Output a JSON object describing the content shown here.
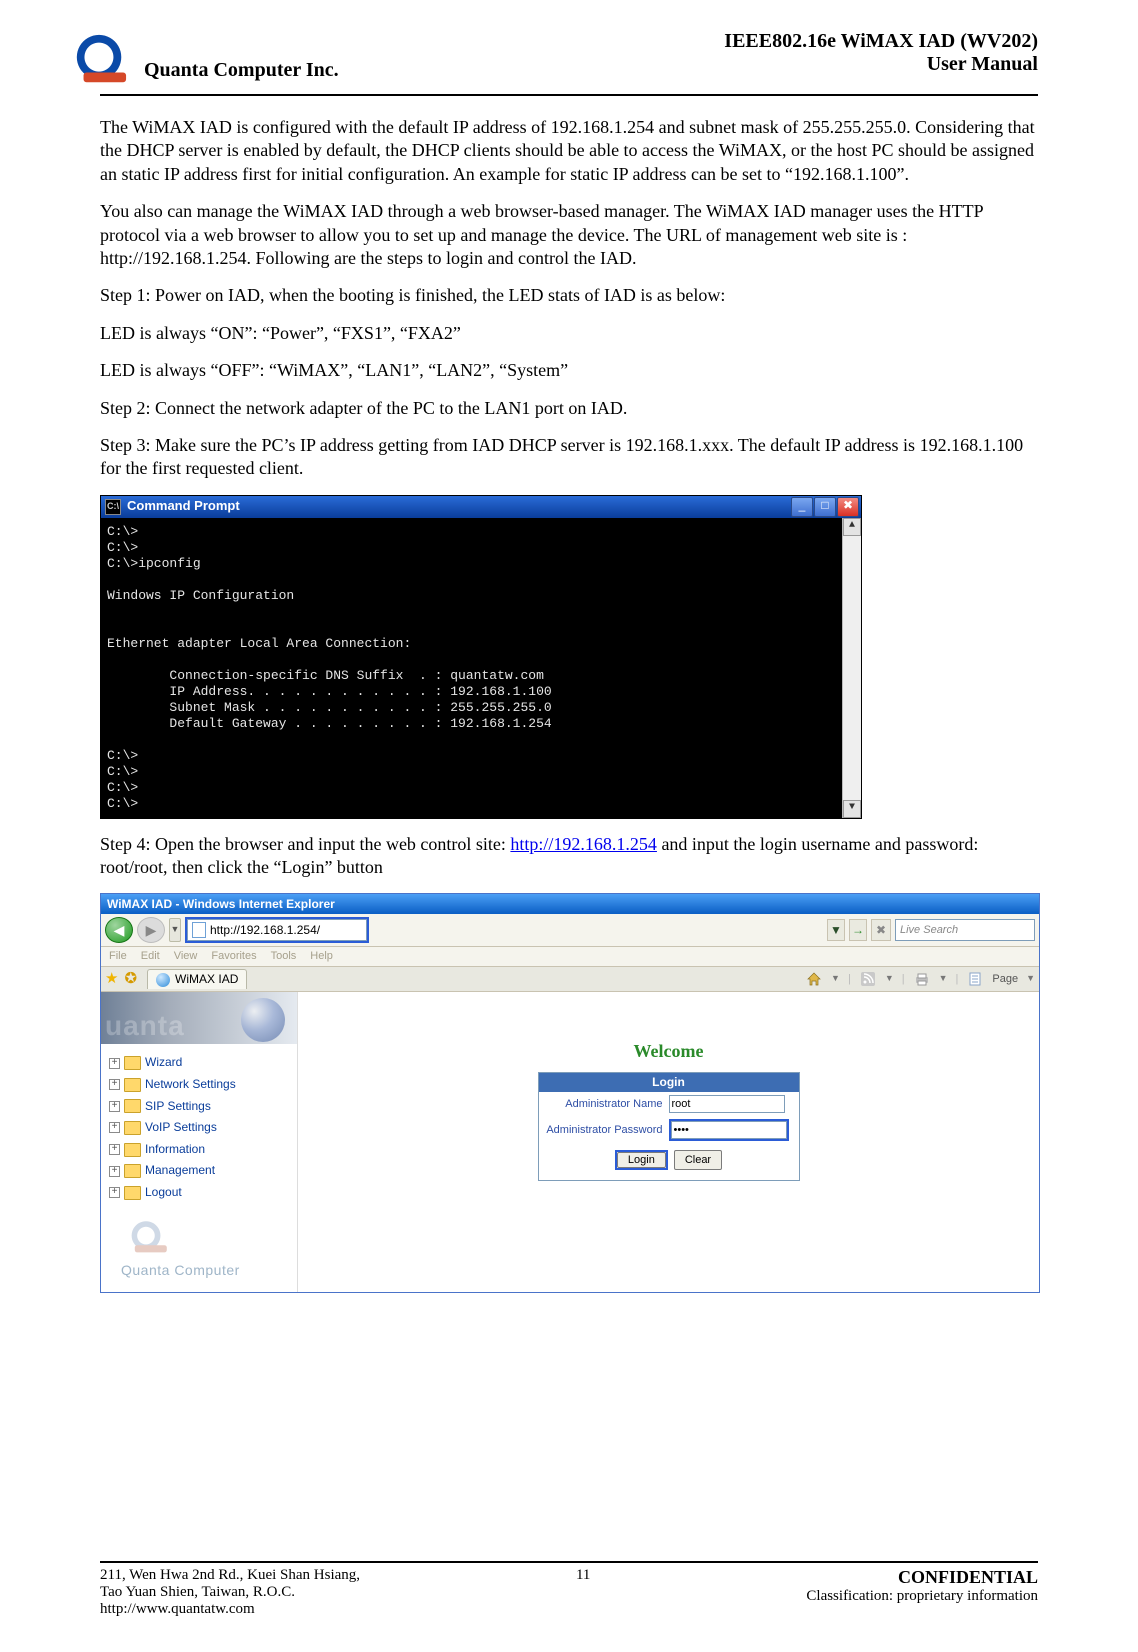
{
  "header": {
    "company": "Quanta  Computer  Inc.",
    "doc_title_1": "IEEE802.16e  WiMAX  IAD  (WV202)",
    "doc_title_2": "User  Manual"
  },
  "body": {
    "p1": "The WiMAX IAD is configured with the default IP address of 192.168.1.254 and subnet mask of 255.255.255.0. Considering that the DHCP server is enabled by default, the DHCP clients should be able to access the WiMAX, or the host PC should be assigned an static IP address first for initial configuration. An example for static IP address can be set to “192.168.1.100”.",
    "p2": "You also can manage the WiMAX IAD through a web browser-based manager. The WiMAX IAD manager uses the HTTP protocol via a web browser to allow you to set up and manage the device. The URL of management web site is : http://192.168.1.254. Following are the steps to login and control the IAD.",
    "p3": "Step 1: Power on IAD, when the booting is finished, the LED stats of IAD is as below:",
    "p3a": "LED is always “ON”: “Power”, “FXS1”, “FXA2”",
    "p3b": "LED is always “OFF”: “WiMAX”, “LAN1”, “LAN2”, “System”",
    "p4": "Step 2: Connect the network adapter of the PC to the LAN1 port on IAD.",
    "p5": "Step 3: Make sure the PC’s IP address getting from IAD DHCP server is 192.168.1.xxx. The default IP address is 192.168.1.100 for the first requested client.",
    "p6_pre": "Step 4: Open the browser and input the web control site: ",
    "p6_link": "http://192.168.1.254",
    "p6_post": " and input the login username and password: root/root, then click the “Login” button"
  },
  "cmd": {
    "title": "Command Prompt",
    "icon": "C:\\",
    "btn_min": "_",
    "btn_max": "□",
    "btn_close": "✖",
    "lines": "C:\\>\nC:\\>\nC:\\>ipconfig\n\nWindows IP Configuration\n\n\nEthernet adapter Local Area Connection:\n\n        Connection-specific DNS Suffix  . : quantatw.com\n        IP Address. . . . . . . . . . . . : 192.168.1.100\n        Subnet Mask . . . . . . . . . . . : 255.255.255.0\n        Default Gateway . . . . . . . . . : 192.168.1.254\n\nC:\\>\nC:\\>\nC:\\>\nC:\\>",
    "scroll_up": "▲",
    "scroll_down": "▼"
  },
  "ie": {
    "title": "WiMAX IAD - Windows Internet Explorer",
    "nav_back": "◀",
    "nav_fwd": "▶",
    "nav_drop": "▼",
    "address": "http://192.168.1.254/",
    "addr_go_arrow": "→",
    "addr_reload": "✖",
    "search_placeholder": "Live Search",
    "addr_search_drop": "▼",
    "menu": {
      "file": "File",
      "edit": "Edit",
      "view": "View",
      "favorites": "Favorites",
      "tools": "Tools",
      "help": "Help"
    },
    "tab": "WiMAX IAD",
    "toolbar": {
      "home_drop": "▼",
      "feed_drop": "▼",
      "print_drop": "▼",
      "page": "Page",
      "page_drop": "▼"
    },
    "sidebar": {
      "banner_text": "uanta",
      "items": [
        {
          "label": "Wizard"
        },
        {
          "label": "Network Settings"
        },
        {
          "label": "SIP Settings"
        },
        {
          "label": "VoIP Settings"
        },
        {
          "label": "Information"
        },
        {
          "label": "Management"
        },
        {
          "label": "Logout"
        }
      ],
      "brand": "Quanta Computer"
    },
    "main": {
      "welcome": "Welcome",
      "login_header": "Login",
      "admin_name_label": "Administrator Name",
      "admin_name_value": "root",
      "admin_pass_label": "Administrator Password",
      "admin_pass_value": "••••",
      "login_btn": "Login",
      "clear_btn": "Clear"
    }
  },
  "footer": {
    "addr1": "211, Wen Hwa 2nd Rd., Kuei Shan Hsiang,",
    "addr2": "Tao Yuan Shien, Taiwan, R.O.C.",
    "addr3": "http://www.quantatw.com",
    "page": "11",
    "conf": "CONFIDENTIAL",
    "class": "Classification: proprietary information"
  }
}
